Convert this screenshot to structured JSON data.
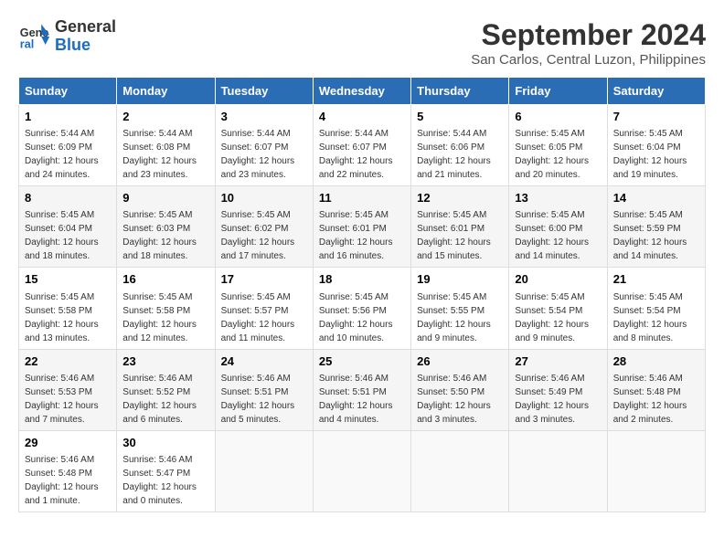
{
  "logo": {
    "line1": "General",
    "line2": "Blue"
  },
  "title": "September 2024",
  "subtitle": "San Carlos, Central Luzon, Philippines",
  "days_of_week": [
    "Sunday",
    "Monday",
    "Tuesday",
    "Wednesday",
    "Thursday",
    "Friday",
    "Saturday"
  ],
  "weeks": [
    [
      {
        "day": "1",
        "sunrise": "5:44 AM",
        "sunset": "6:09 PM",
        "daylight": "12 hours and 24 minutes."
      },
      {
        "day": "2",
        "sunrise": "5:44 AM",
        "sunset": "6:08 PM",
        "daylight": "12 hours and 23 minutes."
      },
      {
        "day": "3",
        "sunrise": "5:44 AM",
        "sunset": "6:07 PM",
        "daylight": "12 hours and 23 minutes."
      },
      {
        "day": "4",
        "sunrise": "5:44 AM",
        "sunset": "6:07 PM",
        "daylight": "12 hours and 22 minutes."
      },
      {
        "day": "5",
        "sunrise": "5:44 AM",
        "sunset": "6:06 PM",
        "daylight": "12 hours and 21 minutes."
      },
      {
        "day": "6",
        "sunrise": "5:45 AM",
        "sunset": "6:05 PM",
        "daylight": "12 hours and 20 minutes."
      },
      {
        "day": "7",
        "sunrise": "5:45 AM",
        "sunset": "6:04 PM",
        "daylight": "12 hours and 19 minutes."
      }
    ],
    [
      {
        "day": "8",
        "sunrise": "5:45 AM",
        "sunset": "6:04 PM",
        "daylight": "12 hours and 18 minutes."
      },
      {
        "day": "9",
        "sunrise": "5:45 AM",
        "sunset": "6:03 PM",
        "daylight": "12 hours and 18 minutes."
      },
      {
        "day": "10",
        "sunrise": "5:45 AM",
        "sunset": "6:02 PM",
        "daylight": "12 hours and 17 minutes."
      },
      {
        "day": "11",
        "sunrise": "5:45 AM",
        "sunset": "6:01 PM",
        "daylight": "12 hours and 16 minutes."
      },
      {
        "day": "12",
        "sunrise": "5:45 AM",
        "sunset": "6:01 PM",
        "daylight": "12 hours and 15 minutes."
      },
      {
        "day": "13",
        "sunrise": "5:45 AM",
        "sunset": "6:00 PM",
        "daylight": "12 hours and 14 minutes."
      },
      {
        "day": "14",
        "sunrise": "5:45 AM",
        "sunset": "5:59 PM",
        "daylight": "12 hours and 14 minutes."
      }
    ],
    [
      {
        "day": "15",
        "sunrise": "5:45 AM",
        "sunset": "5:58 PM",
        "daylight": "12 hours and 13 minutes."
      },
      {
        "day": "16",
        "sunrise": "5:45 AM",
        "sunset": "5:58 PM",
        "daylight": "12 hours and 12 minutes."
      },
      {
        "day": "17",
        "sunrise": "5:45 AM",
        "sunset": "5:57 PM",
        "daylight": "12 hours and 11 minutes."
      },
      {
        "day": "18",
        "sunrise": "5:45 AM",
        "sunset": "5:56 PM",
        "daylight": "12 hours and 10 minutes."
      },
      {
        "day": "19",
        "sunrise": "5:45 AM",
        "sunset": "5:55 PM",
        "daylight": "12 hours and 9 minutes."
      },
      {
        "day": "20",
        "sunrise": "5:45 AM",
        "sunset": "5:54 PM",
        "daylight": "12 hours and 9 minutes."
      },
      {
        "day": "21",
        "sunrise": "5:45 AM",
        "sunset": "5:54 PM",
        "daylight": "12 hours and 8 minutes."
      }
    ],
    [
      {
        "day": "22",
        "sunrise": "5:46 AM",
        "sunset": "5:53 PM",
        "daylight": "12 hours and 7 minutes."
      },
      {
        "day": "23",
        "sunrise": "5:46 AM",
        "sunset": "5:52 PM",
        "daylight": "12 hours and 6 minutes."
      },
      {
        "day": "24",
        "sunrise": "5:46 AM",
        "sunset": "5:51 PM",
        "daylight": "12 hours and 5 minutes."
      },
      {
        "day": "25",
        "sunrise": "5:46 AM",
        "sunset": "5:51 PM",
        "daylight": "12 hours and 4 minutes."
      },
      {
        "day": "26",
        "sunrise": "5:46 AM",
        "sunset": "5:50 PM",
        "daylight": "12 hours and 3 minutes."
      },
      {
        "day": "27",
        "sunrise": "5:46 AM",
        "sunset": "5:49 PM",
        "daylight": "12 hours and 3 minutes."
      },
      {
        "day": "28",
        "sunrise": "5:46 AM",
        "sunset": "5:48 PM",
        "daylight": "12 hours and 2 minutes."
      }
    ],
    [
      {
        "day": "29",
        "sunrise": "5:46 AM",
        "sunset": "5:48 PM",
        "daylight": "12 hours and 1 minute."
      },
      {
        "day": "30",
        "sunrise": "5:46 AM",
        "sunset": "5:47 PM",
        "daylight": "12 hours and 0 minutes."
      },
      null,
      null,
      null,
      null,
      null
    ]
  ],
  "labels": {
    "sunrise": "Sunrise:",
    "sunset": "Sunset:",
    "daylight": "Daylight:"
  }
}
